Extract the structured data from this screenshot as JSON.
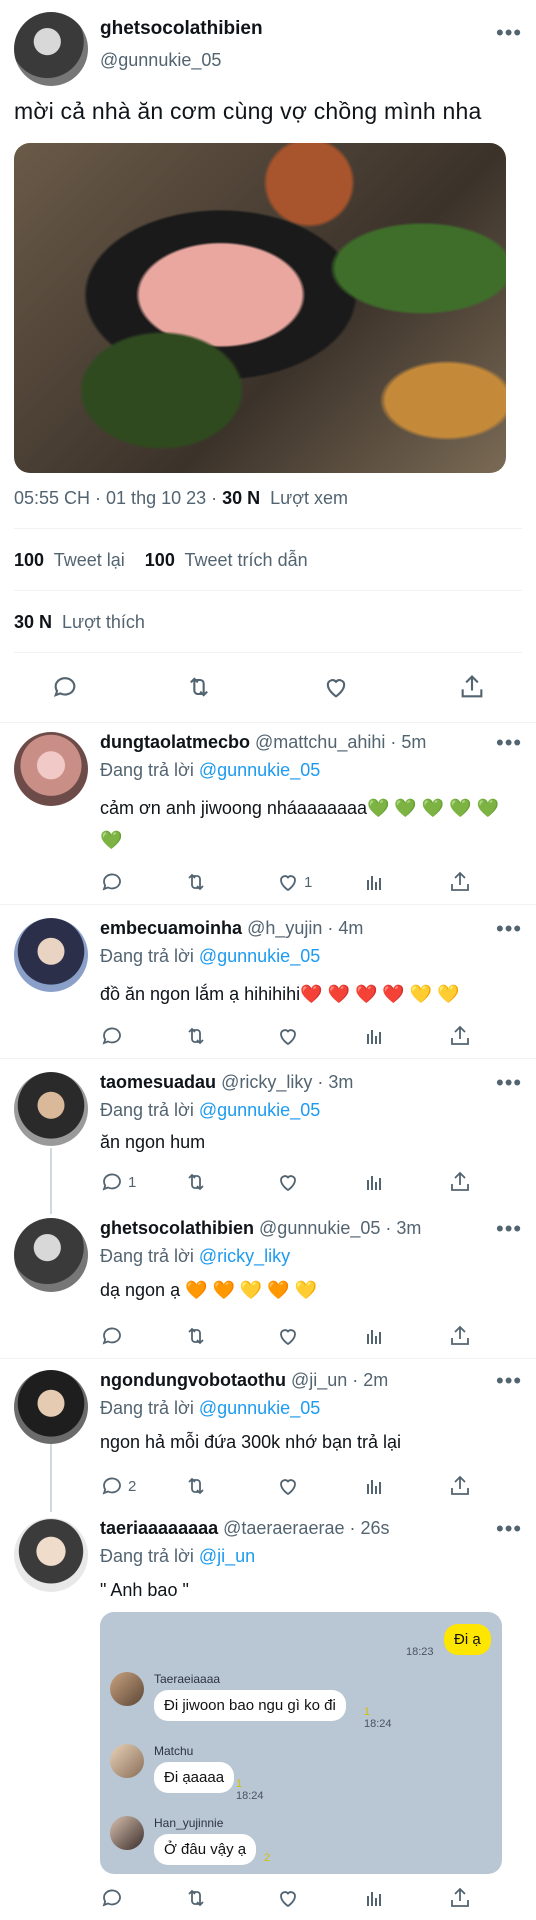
{
  "main": {
    "name": "ghetsocolathibien",
    "handle": "@gunnukie_05",
    "text": "mời cả nhà ăn cơm cùng vợ chồng mình nha",
    "timestamp": "05:55 CH · 01 thg 10 23 · ",
    "views_count": "30 N",
    "views_label": "Lượt xem",
    "retweets_count": "100",
    "retweets_label": "Tweet lại",
    "quotes_count": "100",
    "quotes_label": "Tweet trích dẫn",
    "likes_count": "30 N",
    "likes_label": "Lượt thích",
    "more": "•••"
  },
  "replying_label": "Đang trả lời",
  "replies": [
    {
      "name": "dungtaolatmecbo",
      "handle": "@mattchu_ahihi",
      "time": "· 5m",
      "to": "@gunnukie_05",
      "text": "cảm ơn anh jiwoong nháaaaaaaa",
      "emoji": "💚 💚 💚 💚 💚 💚",
      "reply_count": "",
      "like_count": "1"
    },
    {
      "name": "embecuamoinha",
      "handle": "@h_yujin",
      "time": "· 4m",
      "to": "@gunnukie_05",
      "text": "đồ ăn ngon lắm ạ hihihihi",
      "emoji": "❤️ ❤️ ❤️ ❤️ 💛 💛",
      "reply_count": "",
      "like_count": ""
    },
    {
      "name": "taomesuadau",
      "handle": "@ricky_liky",
      "time": "· 3m",
      "to": "@gunnukie_05",
      "text": "ăn ngon hum",
      "emoji": "",
      "reply_count": "1",
      "like_count": ""
    },
    {
      "name": "ghetsocolathibien",
      "handle": "@gunnukie_05",
      "time": "· 3m",
      "to": "@ricky_liky",
      "text": "dạ ngon ạ",
      "emoji": "🧡 🧡 💛 🧡 💛",
      "reply_count": "",
      "like_count": ""
    },
    {
      "name": "ngondungvobotaothu",
      "handle": "@ji_un",
      "time": "· 2m",
      "to": "@gunnukie_05",
      "text": "ngon hả mỗi đứa 300k nhớ bạn trả lại",
      "emoji": "",
      "reply_count": "2",
      "like_count": ""
    },
    {
      "name": "taeriaaaaaaaa",
      "handle": "@taeraeraerae",
      "time": "· 26s",
      "to": "@ji_un",
      "text": "\" Anh bao \"",
      "emoji": "",
      "reply_count": "",
      "like_count": ""
    }
  ],
  "chat": {
    "my_msg": "Đi ạ",
    "my_time": "18:23",
    "m1_name": "Taeraeiaaaa",
    "m1_text": "Đi jiwoon bao ngu gì ko đi",
    "m1_read": "1",
    "m1_time": "18:24",
    "m2_name": "Matchu",
    "m2_text": "Đi ạaaaa",
    "m2_read": "1",
    "m2_time": "18:24",
    "m3_name": "Han_yujinnie",
    "m3_text": "Ở đâu vậy ạ",
    "m3_read": "2"
  },
  "icons": [
    "reply-icon",
    "retweet-icon",
    "like-icon",
    "share-icon",
    "views-icon",
    "more-icon"
  ]
}
